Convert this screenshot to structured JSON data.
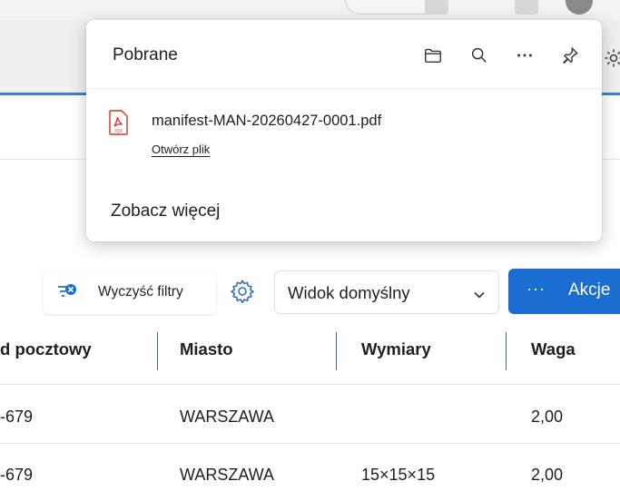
{
  "downloads": {
    "title": "Pobrane",
    "item": {
      "filename": "manifest-MAN-20260427-0001.pdf",
      "action": "Otwórz plik"
    },
    "see_more": "Zobacz więcej"
  },
  "toolbar": {
    "clear_filters": "Wyczyść filtry",
    "view_select": "Widok domyślny",
    "actions_dots": "···",
    "actions": "Akcje"
  },
  "table": {
    "headers": [
      "d pocztowy",
      "Miasto",
      "Wymiary",
      "Waga"
    ],
    "rows": [
      [
        "-679",
        "WARSZAWA",
        "",
        "2,00"
      ],
      [
        "-679",
        "WARSZAWA",
        "15×15×15",
        "2,00"
      ]
    ]
  },
  "colors": {
    "accent": "#1a6ed2",
    "pdf_icon": "#d93025"
  }
}
